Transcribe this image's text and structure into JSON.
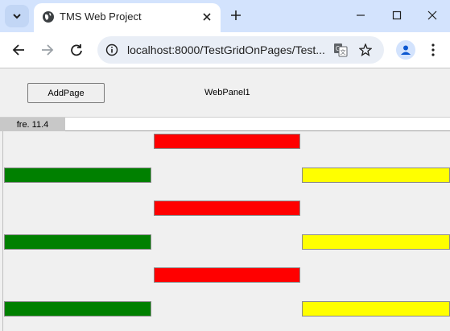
{
  "browser": {
    "tab_title": "TMS Web Project",
    "url": "localhost:8000/TestGridOnPages/Test..."
  },
  "page": {
    "add_page_button": "AddPage",
    "panel_label": "WebPanel1",
    "tabs": [
      {
        "label": "fre. 11.4",
        "active": true
      }
    ]
  },
  "colors": {
    "red": "#ff0000",
    "green": "#008000",
    "yellow": "#ffff00"
  },
  "bars": [
    {
      "color": "red",
      "row": 0,
      "col": 1
    },
    {
      "color": "green",
      "row": 1,
      "col": 0
    },
    {
      "color": "yellow",
      "row": 1,
      "col": 2
    },
    {
      "color": "red",
      "row": 2,
      "col": 1
    },
    {
      "color": "green",
      "row": 3,
      "col": 0
    },
    {
      "color": "yellow",
      "row": 3,
      "col": 2
    },
    {
      "color": "red",
      "row": 4,
      "col": 1
    },
    {
      "color": "green",
      "row": 5,
      "col": 0
    },
    {
      "color": "yellow",
      "row": 5,
      "col": 2
    }
  ]
}
